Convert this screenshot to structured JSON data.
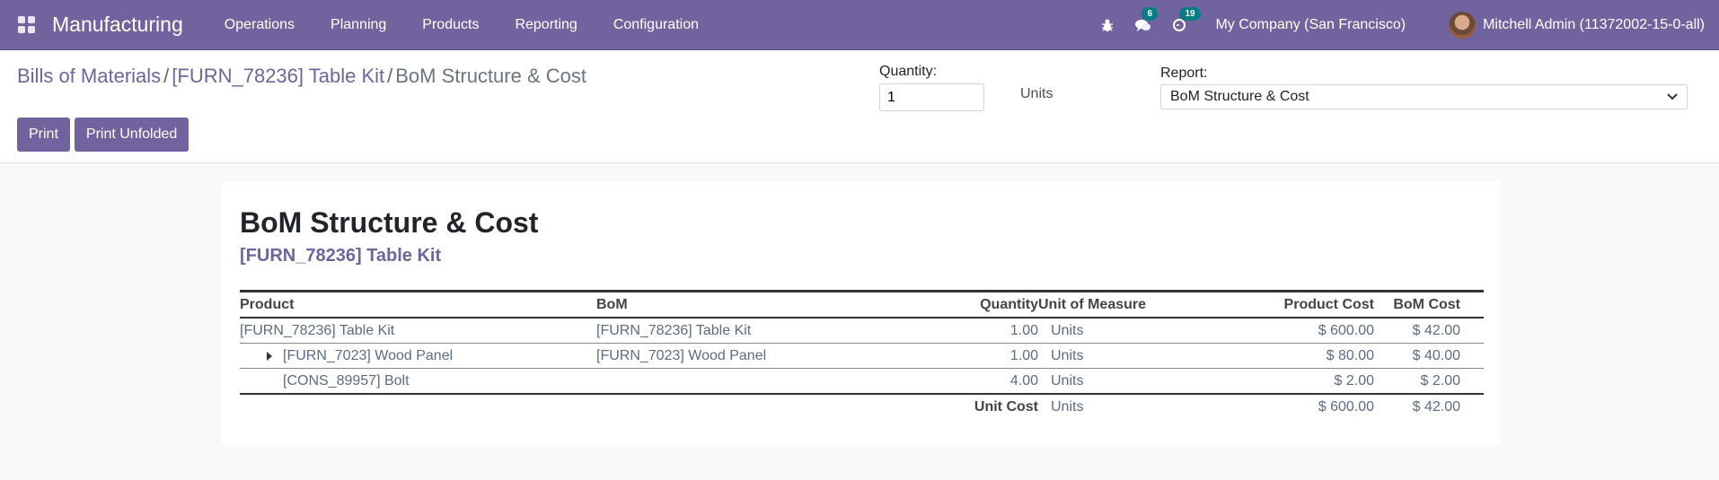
{
  "navbar": {
    "app_name": "Manufacturing",
    "menu": [
      "Operations",
      "Planning",
      "Products",
      "Reporting",
      "Configuration"
    ],
    "icons": {
      "debug": "bug-icon",
      "messages": "chat-icon",
      "activities": "clock-icon"
    },
    "messages_count": "6",
    "activities_count": "19",
    "company": "My Company (San Francisco)",
    "user": "Mitchell Admin (11372002-15-0-all)",
    "brand_color": "#71639e",
    "badge_color": "#017e84"
  },
  "breadcrumb": {
    "items": [
      "Bills of Materials",
      "[FURN_78236] Table Kit"
    ],
    "current": "BoM Structure & Cost",
    "separator": "/"
  },
  "toolbar": {
    "print_label": "Print",
    "print_unfolded_label": "Print Unfolded",
    "quantity_label": "Quantity:",
    "quantity_value": "1",
    "quantity_unit": "Units",
    "report_label": "Report:",
    "report_selected": "BoM Structure & Cost"
  },
  "report": {
    "title": "BoM Structure & Cost",
    "subtitle": "[FURN_78236] Table Kit",
    "columns": [
      "Product",
      "BoM",
      "Quantity",
      "Unit of Measure",
      "Product Cost",
      "BoM Cost"
    ],
    "rows": [
      {
        "product": "[FURN_78236] Table Kit",
        "bom": "[FURN_78236] Table Kit",
        "quantity": "1.00",
        "uom": "Units",
        "product_cost": "$ 600.00",
        "bom_cost": "$ 42.00",
        "expandable": false,
        "level": 0
      },
      {
        "product": "[FURN_7023] Wood Panel",
        "bom": "[FURN_7023] Wood Panel",
        "quantity": "1.00",
        "uom": "Units",
        "product_cost": "$ 80.00",
        "bom_cost": "$ 40.00",
        "expandable": true,
        "level": 1
      },
      {
        "product": "[CONS_89957] Bolt",
        "bom": "",
        "quantity": "4.00",
        "uom": "Units",
        "product_cost": "$ 2.00",
        "bom_cost": "$ 2.00",
        "expandable": false,
        "level": 1
      }
    ],
    "total": {
      "label": "Unit Cost",
      "uom": "Units",
      "product_cost": "$ 600.00",
      "bom_cost": "$ 42.00"
    }
  }
}
